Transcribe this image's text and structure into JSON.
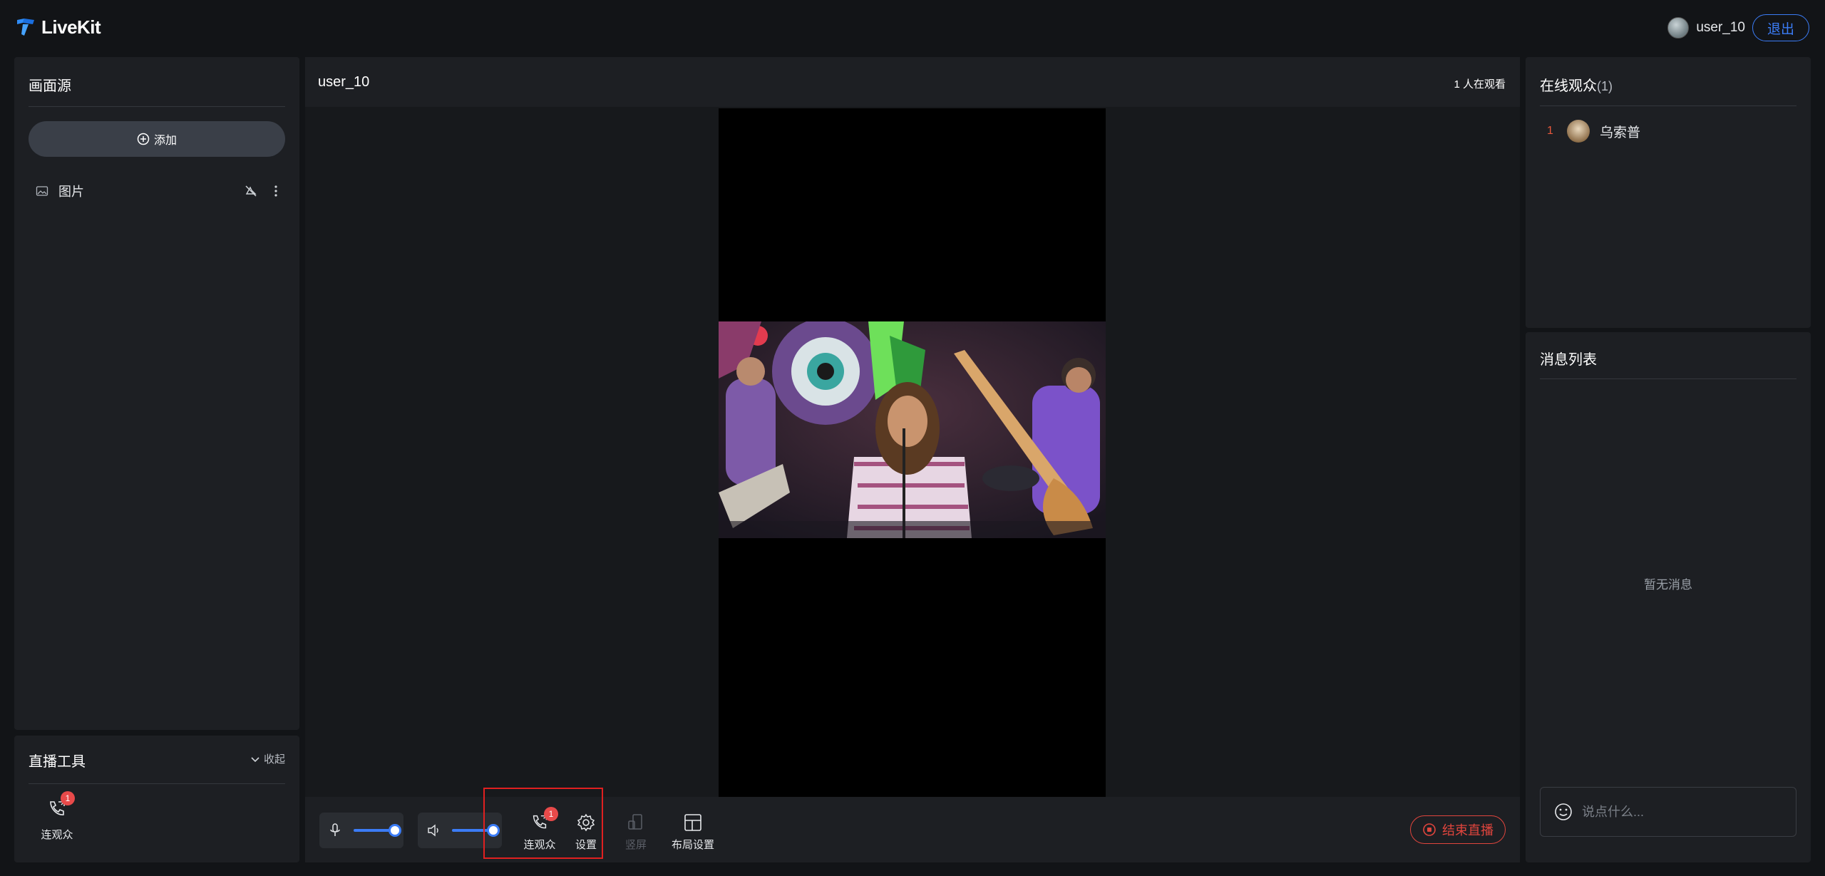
{
  "app": {
    "name": "LiveKit",
    "accent_color": "#3b7cf6",
    "danger_color": "#e0453d"
  },
  "header": {
    "user_name": "user_10",
    "logout_label": "退出"
  },
  "sources_panel": {
    "title": "画面源",
    "add_label": "添加",
    "items": [
      {
        "icon": "image-icon",
        "label": "图片"
      }
    ]
  },
  "tools_panel": {
    "title": "直播工具",
    "collapse_label": "收起",
    "tools": [
      {
        "icon": "phone-connect-icon",
        "label": "连观众",
        "badge": "1"
      }
    ]
  },
  "stage": {
    "host_name": "user_10",
    "viewer_count_text": "1 人在观看"
  },
  "controls": {
    "mic_level": 1.0,
    "speaker_level": 1.0,
    "buttons": {
      "connect_audience": {
        "label": "连观众",
        "badge": "1"
      },
      "settings": {
        "label": "设置"
      },
      "portrait": {
        "label": "竖屏",
        "disabled": true
      },
      "layout": {
        "label": "布局设置"
      }
    },
    "end_live_label": "结束直播"
  },
  "audience_panel": {
    "title": "在线观众",
    "count": "(1)",
    "viewers": [
      {
        "rank": "1",
        "name": "乌索普"
      }
    ]
  },
  "message_panel": {
    "title": "消息列表",
    "empty_text": "暂无消息",
    "input_placeholder": "说点什么..."
  }
}
